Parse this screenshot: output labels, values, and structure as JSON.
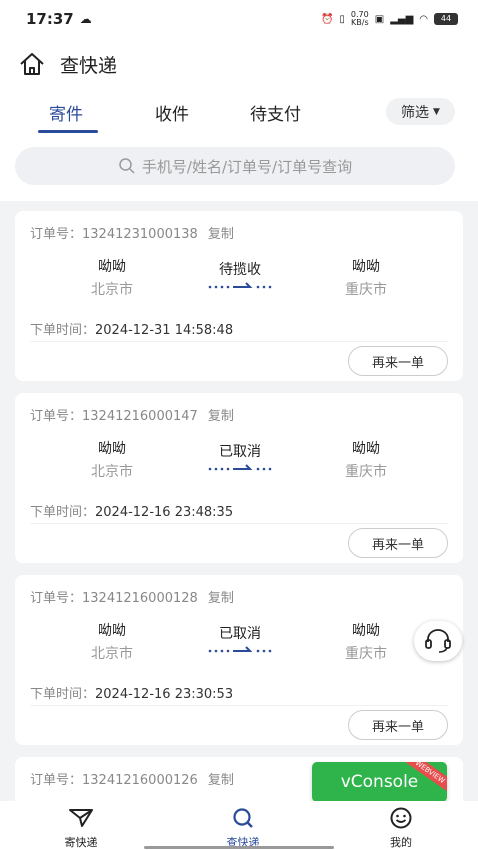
{
  "status_bar": {
    "time": "17:37",
    "net_speed_value": "0.70",
    "net_speed_unit": "KB/s",
    "battery": "44"
  },
  "header": {
    "title": "查快递"
  },
  "tabs": [
    {
      "label": "寄件",
      "active": true
    },
    {
      "label": "收件",
      "active": false
    },
    {
      "label": "待支付",
      "active": false
    }
  ],
  "filter": {
    "label": "筛选"
  },
  "search": {
    "placeholder": "手机号/姓名/订单号/订单号查询"
  },
  "labels": {
    "order_prefix": "订单号：",
    "copy": "复制",
    "time_prefix": "下单时间：",
    "again": "再来一单"
  },
  "orders": [
    {
      "order_no": "13241231000138",
      "sender": "呦呦",
      "from_city": "北京市",
      "status": "待揽收",
      "receiver": "呦呦",
      "to_city": "重庆市",
      "time": "2024-12-31 14:58:48"
    },
    {
      "order_no": "13241216000147",
      "sender": "呦呦",
      "from_city": "北京市",
      "status": "已取消",
      "receiver": "呦呦",
      "to_city": "重庆市",
      "time": "2024-12-16 23:48:35"
    },
    {
      "order_no": "13241216000128",
      "sender": "呦呦",
      "from_city": "北京市",
      "status": "已取消",
      "receiver": "呦呦",
      "to_city": "重庆市",
      "time": "2024-12-16 23:30:53"
    },
    {
      "order_no": "13241216000126"
    }
  ],
  "vconsole": {
    "label": "vConsole",
    "ribbon": "WEBVIEW"
  },
  "bottom_nav": [
    {
      "label": "寄快递",
      "icon": "send-icon",
      "active": false
    },
    {
      "label": "查快递",
      "icon": "search-icon",
      "active": true
    },
    {
      "label": "我的",
      "icon": "smiley-icon",
      "active": false
    }
  ],
  "colors": {
    "accent": "#2a4a9a",
    "vconsole": "#2fb44c"
  }
}
